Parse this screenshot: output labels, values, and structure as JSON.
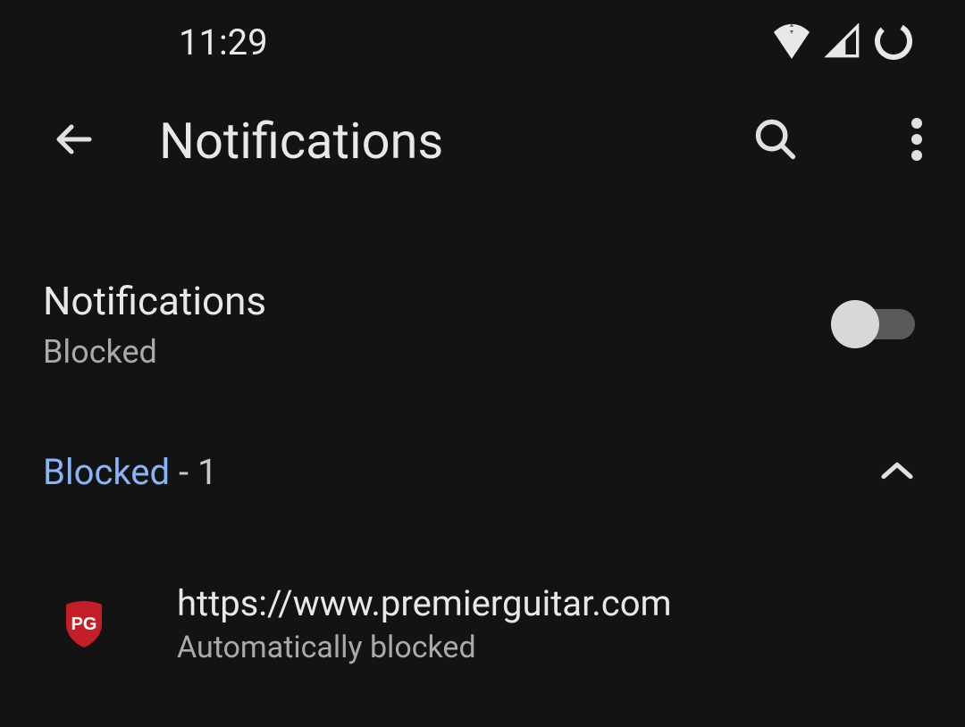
{
  "status_bar": {
    "time": "11:29"
  },
  "header": {
    "title": "Notifications"
  },
  "main_setting": {
    "title": "Notifications",
    "status": "Blocked",
    "enabled": false
  },
  "section": {
    "label": "Blocked",
    "count": "1"
  },
  "sites": [
    {
      "url": "https://www.premierguitar.com",
      "status": "Automatically blocked",
      "icon_label": "PG",
      "icon_color": "#c41e28"
    }
  ]
}
